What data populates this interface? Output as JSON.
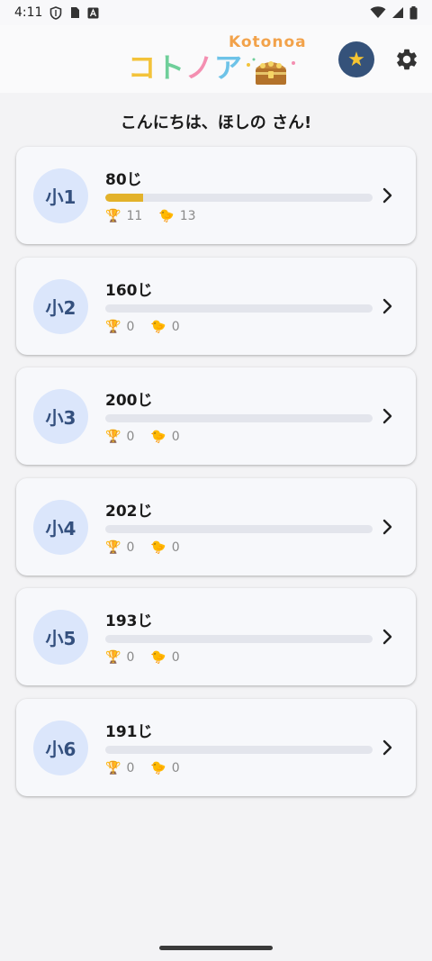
{
  "status_bar": {
    "time": "4:11"
  },
  "header": {
    "logo_jp": "コトノア",
    "logo_en": "Kotonoa",
    "star_icon": "star-icon",
    "settings_icon": "gear-icon"
  },
  "greeting": "こんにちは、ほしの さん!",
  "grades": [
    {
      "grade": "小1",
      "kanji_count": "80じ",
      "progress": 0.14,
      "trophies": "11",
      "chicks": "13"
    },
    {
      "grade": "小2",
      "kanji_count": "160じ",
      "progress": 0,
      "trophies": "0",
      "chicks": "0"
    },
    {
      "grade": "小3",
      "kanji_count": "200じ",
      "progress": 0,
      "trophies": "0",
      "chicks": "0"
    },
    {
      "grade": "小4",
      "kanji_count": "202じ",
      "progress": 0,
      "trophies": "0",
      "chicks": "0"
    },
    {
      "grade": "小5",
      "kanji_count": "193じ",
      "progress": 0,
      "trophies": "0",
      "chicks": "0"
    },
    {
      "grade": "小6",
      "kanji_count": "191じ",
      "progress": 0,
      "trophies": "0",
      "chicks": "0"
    }
  ],
  "icons": {
    "trophy": "🏆",
    "chick": "🐤"
  },
  "colors": {
    "accent": "#e3b22a",
    "grade_circle": "#dbe6fb",
    "grade_text": "#34507e",
    "star_button": "#35527a"
  }
}
